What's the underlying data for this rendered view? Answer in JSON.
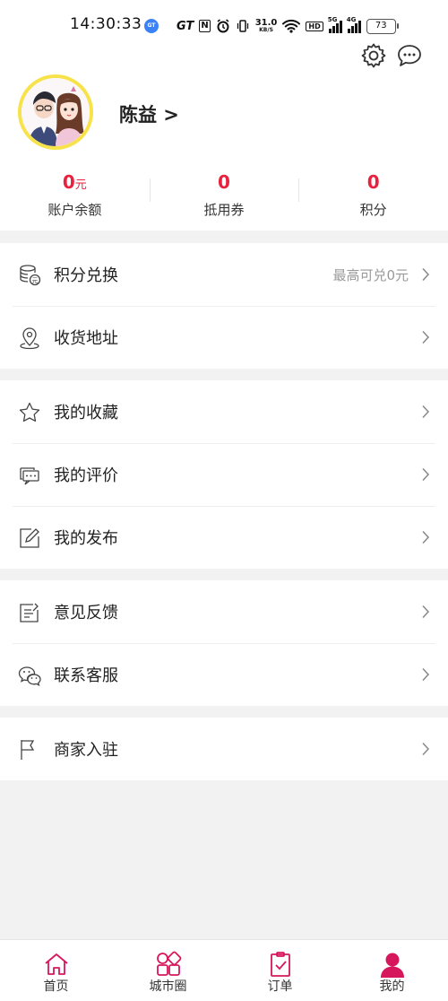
{
  "status_bar": {
    "time": "14:30:33",
    "carrier_badge": "GT",
    "gt_label": "GT",
    "nfc_label": "N",
    "net_speed_value": "31.0",
    "net_speed_unit": "KB/S",
    "hd_label": "HD",
    "sim1_label": "5G",
    "sim2_label": "4G",
    "battery": "73"
  },
  "profile": {
    "name": "陈益 >",
    "avatar_ring_color": "#f7e24a"
  },
  "stats": [
    {
      "value": "0",
      "unit": "元",
      "label": "账户余额"
    },
    {
      "value": "0",
      "unit": "",
      "label": "抵用券"
    },
    {
      "value": "0",
      "unit": "",
      "label": "积分"
    }
  ],
  "menu": {
    "group1": [
      {
        "label": "积分兑换",
        "extra": "最高可兑0元",
        "icon": "coins-icon"
      },
      {
        "label": "收货地址",
        "extra": "",
        "icon": "location-icon"
      }
    ],
    "group2": [
      {
        "label": "我的收藏",
        "extra": "",
        "icon": "star-icon"
      },
      {
        "label": "我的评价",
        "extra": "",
        "icon": "comment-icon"
      },
      {
        "label": "我的发布",
        "extra": "",
        "icon": "edit-icon"
      }
    ],
    "group3": [
      {
        "label": "意见反馈",
        "extra": "",
        "icon": "feedback-icon"
      },
      {
        "label": "联系客服",
        "extra": "",
        "icon": "wechat-icon"
      }
    ],
    "group4": [
      {
        "label": "商家入驻",
        "extra": "",
        "icon": "flag-icon"
      }
    ]
  },
  "tabs": [
    {
      "label": "首页",
      "icon": "home-icon"
    },
    {
      "label": "城市圈",
      "icon": "grid-icon"
    },
    {
      "label": "订单",
      "icon": "clipboard-icon"
    },
    {
      "label": "我的",
      "icon": "user-icon",
      "active": true
    }
  ],
  "colors": {
    "accent": "#e8213f",
    "tab_accent": "#d6175c",
    "background": "#f2f2f2"
  }
}
